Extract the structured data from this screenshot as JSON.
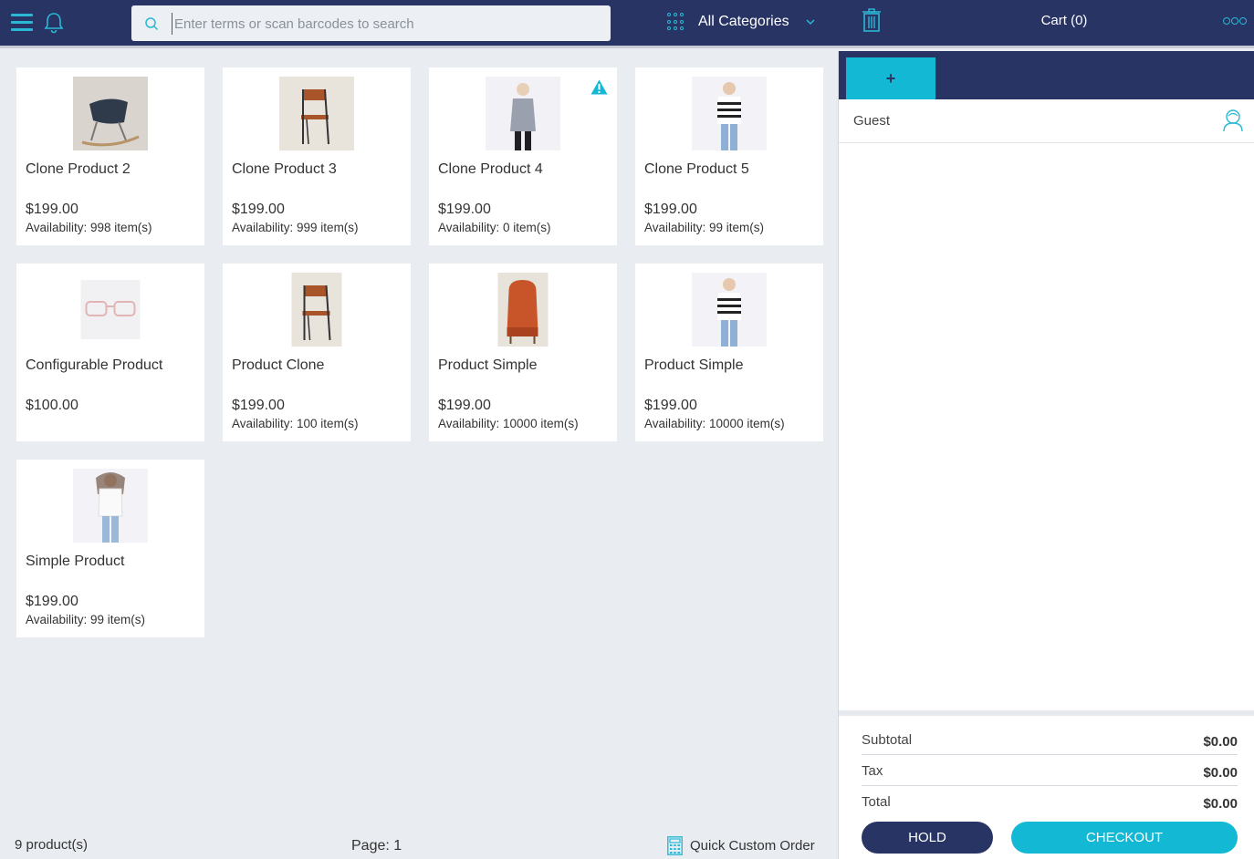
{
  "header": {
    "search_placeholder": "Enter terms or scan barcodes to search",
    "category_label": "All Categories",
    "cart_title": "Cart (0)"
  },
  "products": [
    {
      "name": "Clone Product 2",
      "price": "$199.00",
      "availability": "Availability: 998 item(s)",
      "image": "rocking-chair-icon",
      "warning": false
    },
    {
      "name": "Clone Product 3",
      "price": "$199.00",
      "availability": "Availability: 999 item(s)",
      "image": "chair-icon",
      "warning": false
    },
    {
      "name": "Clone Product 4",
      "price": "$199.00",
      "availability": "Availability: 0 item(s)",
      "image": "person-sweater-icon",
      "warning": true
    },
    {
      "name": "Clone Product 5",
      "price": "$199.00",
      "availability": "Availability: 99 item(s)",
      "image": "person-striped-icon",
      "warning": false
    },
    {
      "name": "Configurable Product",
      "price": "$100.00",
      "availability": "",
      "image": "glasses-icon",
      "warning": false
    },
    {
      "name": "Product Clone",
      "price": "$199.00",
      "availability": "Availability: 100 item(s)",
      "image": "chair-icon",
      "warning": false
    },
    {
      "name": "Product Simple",
      "price": "$199.00",
      "availability": "Availability: 10000 item(s)",
      "image": "armchair-icon",
      "warning": false
    },
    {
      "name": "Product Simple",
      "price": "$199.00",
      "availability": "Availability: 10000 item(s)",
      "image": "person-striped-icon",
      "warning": false
    },
    {
      "name": "Simple Product",
      "price": "$199.00",
      "availability": "Availability: 99 item(s)",
      "image": "person-white-icon",
      "warning": false
    }
  ],
  "footer": {
    "count": "9 product(s)",
    "page": "Page: 1",
    "quick_order": "Quick Custom Order"
  },
  "cart": {
    "add_tab": "+",
    "customer": "Guest",
    "subtotal_label": "Subtotal",
    "subtotal_value": "$0.00",
    "tax_label": "Tax",
    "tax_value": "$0.00",
    "total_label": "Total",
    "total_value": "$0.00",
    "hold_label": "HOLD",
    "checkout_label": "CHECKOUT"
  },
  "colors": {
    "header_bg": "#283463",
    "accent": "#12b8d4",
    "page_bg": "#e9ecf1"
  }
}
